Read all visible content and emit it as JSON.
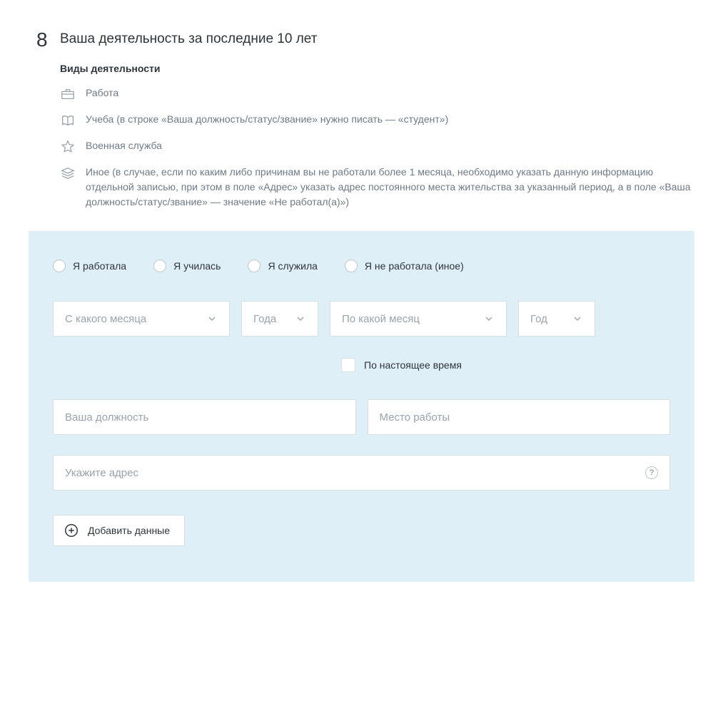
{
  "step_number": "8",
  "section_title": "Ваша деятельность за последние 10 лет",
  "sub_heading": "Виды деятельности",
  "legend": {
    "work": "Работа",
    "study": "Учеба (в строке «Ваша должность/статус/звание» нужно писать — «студент»)",
    "military": "Военная служба",
    "other": "Иное (в случае, если по каким либо причинам вы не работали более 1 месяца, необходимо указать данную информацию отдельной записью, при этом в поле «Адрес» указать адрес постоянного места жительства за указанный период, а в поле «Ваша должность/статус/звание» — значение «Не работал(а)»)"
  },
  "radios": {
    "worked": "Я работала",
    "studied": "Я училась",
    "served": "Я служила",
    "not_worked": "Я не работала (иное)"
  },
  "period": {
    "from_month": "С какого месяца",
    "from_year": "Года",
    "to_month": "По какой месяц",
    "to_year": "Год"
  },
  "present_label": "По настоящее время",
  "inputs": {
    "position": "Ваша должность",
    "workplace": "Место работы",
    "address": "Укажите адрес"
  },
  "help_symbol": "?",
  "add_button": "Добавить данные"
}
